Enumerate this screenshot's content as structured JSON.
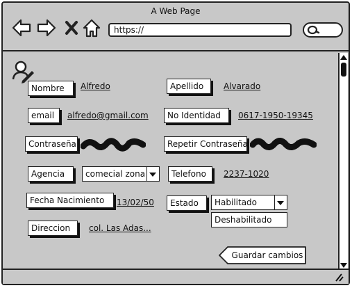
{
  "window": {
    "title": "A Web Page"
  },
  "browser": {
    "url": "https://"
  },
  "form": {
    "nombre": {
      "label": "Nombre",
      "value": "Alfredo"
    },
    "apellido": {
      "label": "Apellido",
      "value": "Alvarado"
    },
    "email": {
      "label": "email",
      "value": "alfredo@gmail.com"
    },
    "identidad": {
      "label": "No Identidad",
      "value": "0617-1950-19345"
    },
    "contrasena": {
      "label": "Contraseña"
    },
    "repetir": {
      "label": "Repetir Contraseña"
    },
    "agencia": {
      "label": "Agencia",
      "selected": "comecial zona"
    },
    "telefono": {
      "label": "Telefono",
      "value": "2237-1020"
    },
    "fecha": {
      "label": "Fecha Nacimiento",
      "value": "13/02/50"
    },
    "estado": {
      "label": "Estado",
      "selected": "Habilitado",
      "options": [
        "Deshabilitado"
      ]
    },
    "direccion": {
      "label": "Direccion",
      "value": "col. Las Adas..."
    },
    "save_label": "Guardar cambios"
  },
  "icons": {
    "user_edit": "user-edit-icon",
    "back": "arrow-left-icon",
    "forward": "arrow-right-icon",
    "close": "close-icon",
    "home": "home-icon",
    "search": "search-icon"
  }
}
